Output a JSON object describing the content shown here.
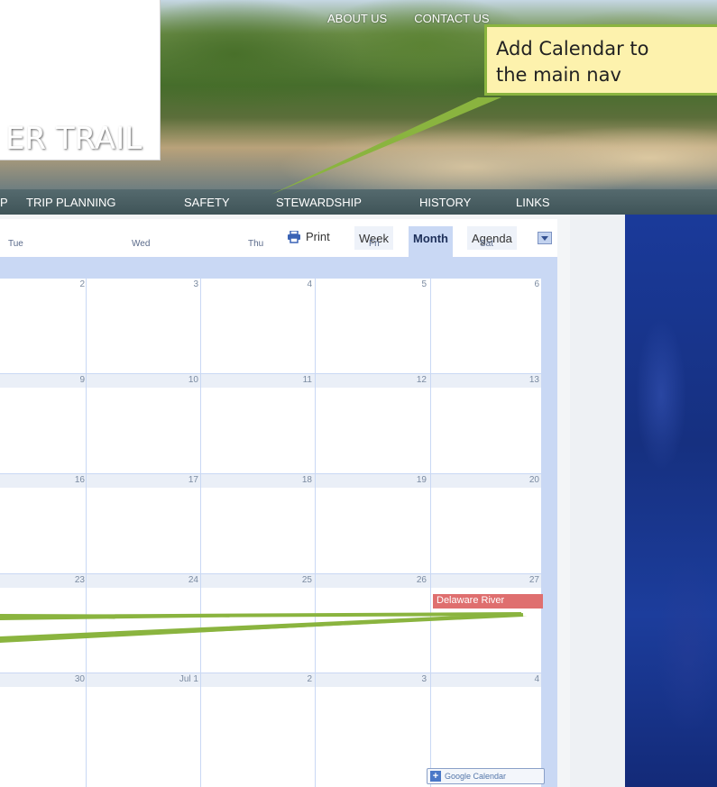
{
  "header": {
    "site_title": "ER TRAIL",
    "top_links": [
      "ABOUT US",
      "CONTACT US"
    ]
  },
  "main_nav": {
    "items": [
      "P",
      "TRIP PLANNING",
      "SAFETY",
      "STEWARDSHIP",
      "HISTORY",
      "LINKS"
    ]
  },
  "calendar": {
    "toolbar": {
      "print_label": "Print",
      "views": [
        "Week",
        "Month",
        "Agenda"
      ],
      "active_view": "Month"
    },
    "weekdays": [
      "Tue",
      "Wed",
      "Thu",
      "Fri",
      "Sat"
    ],
    "weeks": [
      [
        "2",
        "3",
        "4",
        "5",
        "6"
      ],
      [
        "9",
        "10",
        "11",
        "12",
        "13"
      ],
      [
        "16",
        "17",
        "18",
        "19",
        "20"
      ],
      [
        "23",
        "24",
        "25",
        "26",
        "27"
      ],
      [
        "30",
        "Jul 1",
        "2",
        "3",
        "4"
      ]
    ],
    "event": {
      "title": "Delaware River",
      "color": "#df6f6f"
    },
    "badge_label": "Google Calendar"
  },
  "callout": {
    "text": "Add Calendar to\nthe main nav",
    "border_color": "#8ab43f",
    "fill_color": "#fdf2ad"
  }
}
